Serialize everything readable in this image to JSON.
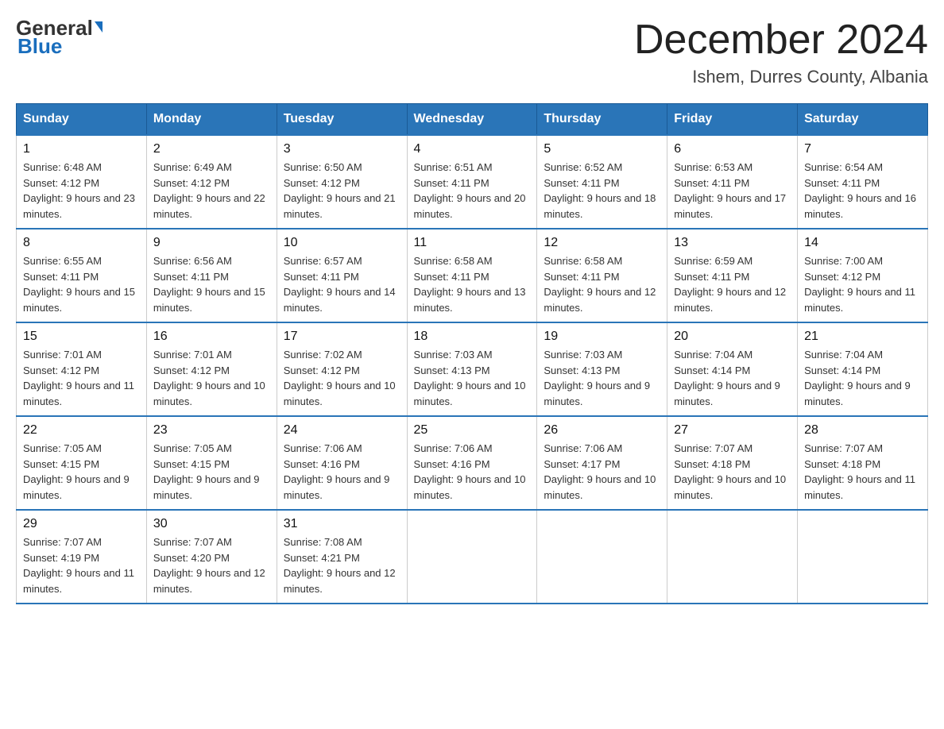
{
  "logo": {
    "general": "General",
    "blue": "Blue"
  },
  "header": {
    "month": "December 2024",
    "location": "Ishem, Durres County, Albania"
  },
  "days_of_week": [
    "Sunday",
    "Monday",
    "Tuesday",
    "Wednesday",
    "Thursday",
    "Friday",
    "Saturday"
  ],
  "weeks": [
    [
      {
        "day": "1",
        "sunrise": "6:48 AM",
        "sunset": "4:12 PM",
        "daylight": "9 hours and 23 minutes."
      },
      {
        "day": "2",
        "sunrise": "6:49 AM",
        "sunset": "4:12 PM",
        "daylight": "9 hours and 22 minutes."
      },
      {
        "day": "3",
        "sunrise": "6:50 AM",
        "sunset": "4:12 PM",
        "daylight": "9 hours and 21 minutes."
      },
      {
        "day": "4",
        "sunrise": "6:51 AM",
        "sunset": "4:11 PM",
        "daylight": "9 hours and 20 minutes."
      },
      {
        "day": "5",
        "sunrise": "6:52 AM",
        "sunset": "4:11 PM",
        "daylight": "9 hours and 18 minutes."
      },
      {
        "day": "6",
        "sunrise": "6:53 AM",
        "sunset": "4:11 PM",
        "daylight": "9 hours and 17 minutes."
      },
      {
        "day": "7",
        "sunrise": "6:54 AM",
        "sunset": "4:11 PM",
        "daylight": "9 hours and 16 minutes."
      }
    ],
    [
      {
        "day": "8",
        "sunrise": "6:55 AM",
        "sunset": "4:11 PM",
        "daylight": "9 hours and 15 minutes."
      },
      {
        "day": "9",
        "sunrise": "6:56 AM",
        "sunset": "4:11 PM",
        "daylight": "9 hours and 15 minutes."
      },
      {
        "day": "10",
        "sunrise": "6:57 AM",
        "sunset": "4:11 PM",
        "daylight": "9 hours and 14 minutes."
      },
      {
        "day": "11",
        "sunrise": "6:58 AM",
        "sunset": "4:11 PM",
        "daylight": "9 hours and 13 minutes."
      },
      {
        "day": "12",
        "sunrise": "6:58 AM",
        "sunset": "4:11 PM",
        "daylight": "9 hours and 12 minutes."
      },
      {
        "day": "13",
        "sunrise": "6:59 AM",
        "sunset": "4:11 PM",
        "daylight": "9 hours and 12 minutes."
      },
      {
        "day": "14",
        "sunrise": "7:00 AM",
        "sunset": "4:12 PM",
        "daylight": "9 hours and 11 minutes."
      }
    ],
    [
      {
        "day": "15",
        "sunrise": "7:01 AM",
        "sunset": "4:12 PM",
        "daylight": "9 hours and 11 minutes."
      },
      {
        "day": "16",
        "sunrise": "7:01 AM",
        "sunset": "4:12 PM",
        "daylight": "9 hours and 10 minutes."
      },
      {
        "day": "17",
        "sunrise": "7:02 AM",
        "sunset": "4:12 PM",
        "daylight": "9 hours and 10 minutes."
      },
      {
        "day": "18",
        "sunrise": "7:03 AM",
        "sunset": "4:13 PM",
        "daylight": "9 hours and 10 minutes."
      },
      {
        "day": "19",
        "sunrise": "7:03 AM",
        "sunset": "4:13 PM",
        "daylight": "9 hours and 9 minutes."
      },
      {
        "day": "20",
        "sunrise": "7:04 AM",
        "sunset": "4:14 PM",
        "daylight": "9 hours and 9 minutes."
      },
      {
        "day": "21",
        "sunrise": "7:04 AM",
        "sunset": "4:14 PM",
        "daylight": "9 hours and 9 minutes."
      }
    ],
    [
      {
        "day": "22",
        "sunrise": "7:05 AM",
        "sunset": "4:15 PM",
        "daylight": "9 hours and 9 minutes."
      },
      {
        "day": "23",
        "sunrise": "7:05 AM",
        "sunset": "4:15 PM",
        "daylight": "9 hours and 9 minutes."
      },
      {
        "day": "24",
        "sunrise": "7:06 AM",
        "sunset": "4:16 PM",
        "daylight": "9 hours and 9 minutes."
      },
      {
        "day": "25",
        "sunrise": "7:06 AM",
        "sunset": "4:16 PM",
        "daylight": "9 hours and 10 minutes."
      },
      {
        "day": "26",
        "sunrise": "7:06 AM",
        "sunset": "4:17 PM",
        "daylight": "9 hours and 10 minutes."
      },
      {
        "day": "27",
        "sunrise": "7:07 AM",
        "sunset": "4:18 PM",
        "daylight": "9 hours and 10 minutes."
      },
      {
        "day": "28",
        "sunrise": "7:07 AM",
        "sunset": "4:18 PM",
        "daylight": "9 hours and 11 minutes."
      }
    ],
    [
      {
        "day": "29",
        "sunrise": "7:07 AM",
        "sunset": "4:19 PM",
        "daylight": "9 hours and 11 minutes."
      },
      {
        "day": "30",
        "sunrise": "7:07 AM",
        "sunset": "4:20 PM",
        "daylight": "9 hours and 12 minutes."
      },
      {
        "day": "31",
        "sunrise": "7:08 AM",
        "sunset": "4:21 PM",
        "daylight": "9 hours and 12 minutes."
      },
      null,
      null,
      null,
      null
    ]
  ]
}
